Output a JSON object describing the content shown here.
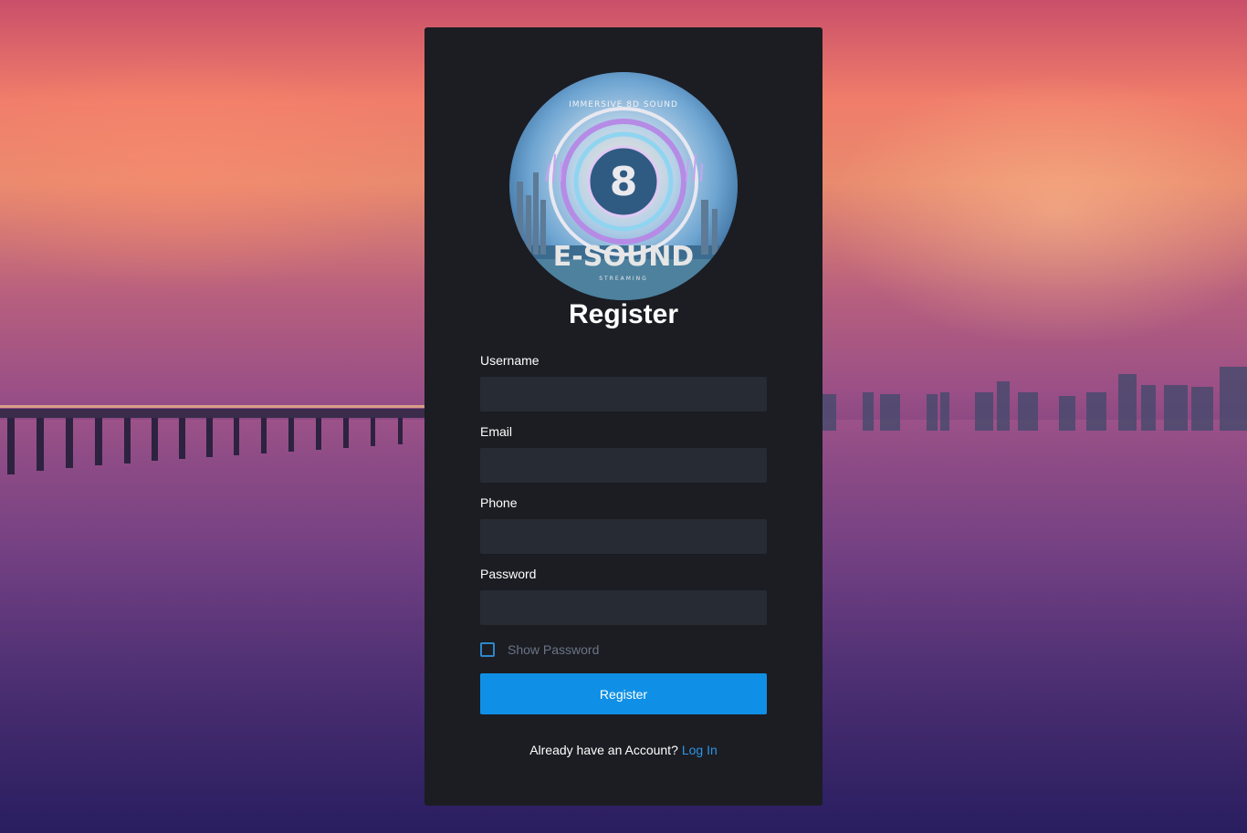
{
  "form": {
    "title": "Register",
    "logo": {
      "brand": "E-SOUND",
      "tagline": "IMMERSIVE 8D SOUND",
      "subtext": "STREAMING",
      "emblem": "8"
    },
    "fields": [
      {
        "label": "Username",
        "value": "",
        "placeholder": ""
      },
      {
        "label": "Email",
        "value": "",
        "placeholder": ""
      },
      {
        "label": "Phone",
        "value": "",
        "placeholder": ""
      },
      {
        "label": "Password",
        "value": "",
        "placeholder": ""
      }
    ],
    "show_password_label": "Show Password",
    "submit_label": "Register",
    "footer_text": "Already have an Account?",
    "login_link": "Log In"
  },
  "colors": {
    "card": "#1b1d23",
    "input": "#272b33",
    "accent": "#0f90e6",
    "link": "#2f94e6"
  }
}
